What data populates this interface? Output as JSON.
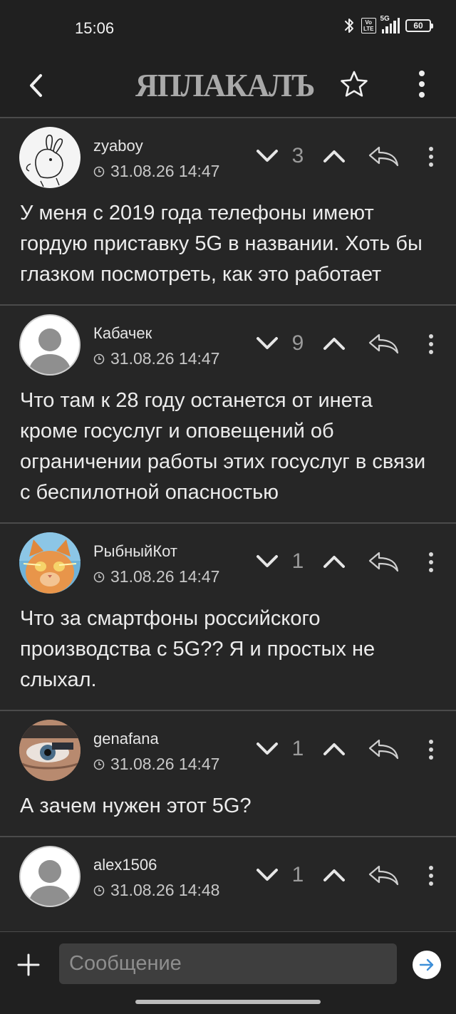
{
  "status_bar": {
    "time": "15:06",
    "volte": "Vo\nLTE",
    "network": "5G",
    "battery": "60"
  },
  "header": {
    "logo": "ЯПЛАКАЛЪ",
    "back_icon": "chevron-left-icon",
    "favorite_icon": "star-icon",
    "menu_icon": "vertical-dots-icon"
  },
  "comments": [
    {
      "username": "zyaboy",
      "date": "31.08.26 14:47",
      "rating": "3",
      "text": "У меня с 2019 года телефоны имеют гордую приставку 5G в названии. Хоть бы глазком посмотреть, как это работает",
      "avatar": "rabbit-sketch"
    },
    {
      "username": "Кабачек",
      "date": "31.08.26 14:47",
      "rating": "9",
      "text": "Что там к 28 году останется от инета кроме госуслуг и оповещений об ограничении работы этих госуслуг в связи с беспилотной опасностью",
      "avatar": "default-user"
    },
    {
      "username": "РыбныйКот",
      "date": "31.08.26 14:47",
      "rating": "1",
      "text": "Что за смартфоны российского производства с 5G?? Я и простых не слыхал.",
      "avatar": "cat-photo"
    },
    {
      "username": "genafana",
      "date": "31.08.26 14:47",
      "rating": "1",
      "text": "А зачем нужен этот 5G?",
      "avatar": "eye-photo"
    },
    {
      "username": "alex1506",
      "date": "31.08.26 14:48",
      "rating": "1",
      "text": "",
      "avatar": "default-user"
    }
  ],
  "composer": {
    "placeholder": "Сообщение",
    "add_icon": "plus-icon",
    "send_icon": "send-arrow-icon"
  },
  "colors": {
    "background": "#202020",
    "card": "#262626",
    "divider": "#4b4b4b",
    "text": "#ececec",
    "muted": "#9b9b9b"
  }
}
